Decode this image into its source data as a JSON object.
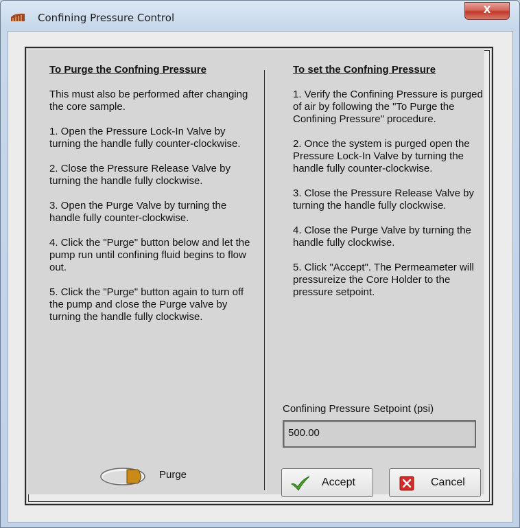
{
  "window": {
    "title": "Confining Pressure Control",
    "close_label": "X"
  },
  "purge_section": {
    "heading": "To Purge the Confning Pressure",
    "paragraphs": [
      "This must also be performed after changing the core sample.",
      "1. Open the Pressure Lock-In Valve by turning the handle fully counter-clockwise.",
      "2. Close the Pressure Release Valve by turning the handle fully clockwise.",
      "3. Open the Purge Valve by turning the handle fully counter-clockwise.",
      "4. Click the \"Purge\" button below and let the pump run until confining fluid begins to flow out.",
      "5. Click the \"Purge\" button again to turn off the pump and close the Purge valve by turning the handle fully clockwise."
    ],
    "purge_button_label": "Purge"
  },
  "set_section": {
    "heading": "To set the Confning Pressure",
    "paragraphs": [
      "1. Verify the Confining Pressure is purged of air by following the \"To Purge the Confining Pressure\" procedure.",
      "2. Once the system is purged open the Pressure Lock-In Valve by turning the handle fully counter-clockwise.",
      "3. Close the Pressure Release Valve by turning the handle fully clockwise.",
      "4. Close the Purge Valve by turning the handle fully clockwise.",
      "5. Click \"Accept\". The Permeameter will pressureize the Core Holder to the pressure setpoint."
    ],
    "setpoint_label": "Confining Pressure Setpoint (psi)",
    "setpoint_value": "500.00"
  },
  "buttons": {
    "accept_label": "Accept",
    "cancel_label": "Cancel"
  },
  "icons": {
    "app": "pressure-gauge-icon",
    "accept": "checkmark-icon",
    "cancel": "red-x-icon",
    "purge_toggle": "toggle-led-icon"
  },
  "colors": {
    "cancel_red": "#d42a2a",
    "accept_green": "#4aa02c",
    "toggle_led": "#c98a17"
  }
}
